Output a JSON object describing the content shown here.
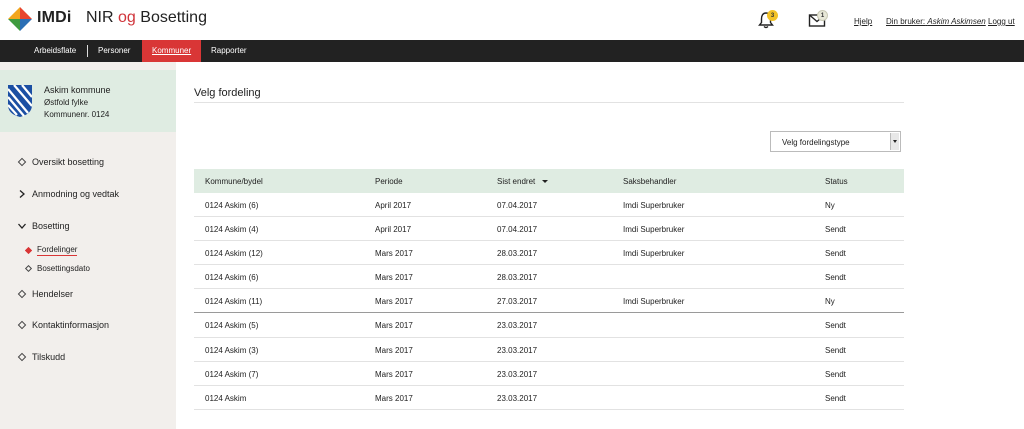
{
  "header": {
    "logo_text": "IMDi",
    "app_title_part1": "NIR",
    "app_title_og": "og",
    "app_title_part2": "Bosetting",
    "notifications_count": "3",
    "messages_count": "1",
    "help_label": "Hjelp",
    "user_prefix": "Din bruker:",
    "user_name": "Askim Askimsen",
    "logout_label": "Logg ut"
  },
  "nav": {
    "items": [
      {
        "label": "Arbeidsflate"
      },
      {
        "label": "Personer"
      },
      {
        "label": "Kommuner"
      },
      {
        "label": "Rapporter"
      }
    ],
    "active_index": 2
  },
  "sidebar": {
    "municipality": {
      "name": "Askim kommune",
      "county": "Østfold fylke",
      "number": "Kommunenr. 0124"
    },
    "items": [
      {
        "label": "Oversikt bosetting",
        "icon": "diamond-icon"
      },
      {
        "label": "Anmodning og vedtak",
        "icon": "chevron-right-icon"
      },
      {
        "label": "Bosetting",
        "icon": "chevron-down-icon"
      },
      {
        "label": "Hendelser",
        "icon": "diamond-icon"
      },
      {
        "label": "Kontaktinformasjon",
        "icon": "diamond-icon"
      },
      {
        "label": "Tilskudd",
        "icon": "diamond-icon"
      }
    ],
    "sub_items": [
      {
        "label": "Fordelinger",
        "active": true
      },
      {
        "label": "Bosettingsdato",
        "active": false
      }
    ]
  },
  "main": {
    "title": "Velg fordeling",
    "select_placeholder": "Velg fordelingstype",
    "table": {
      "columns": [
        "Kommune/bydel",
        "Periode",
        "Sist endret",
        "Saksbehandler",
        "Status"
      ],
      "sorted_column": "Sist endret",
      "rows": [
        [
          "0124 Askim (6)",
          "April 2017",
          "07.04.2017",
          "Imdi Superbruker",
          "Ny"
        ],
        [
          "0124 Askim (4)",
          "April 2017",
          "07.04.2017",
          "Imdi Superbruker",
          "Sendt"
        ],
        [
          "0124 Askim (12)",
          "Mars 2017",
          "28.03.2017",
          "Imdi Superbruker",
          "Sendt"
        ],
        [
          "0124 Askim (6)",
          "Mars 2017",
          "28.03.2017",
          "",
          "Sendt"
        ],
        [
          "0124 Askim (11)",
          "Mars 2017",
          "27.03.2017",
          "Imdi Superbruker",
          "Ny"
        ],
        [
          "0124 Askim (5)",
          "Mars 2017",
          "23.03.2017",
          "",
          "Sendt"
        ],
        [
          "0124 Askim (3)",
          "Mars 2017",
          "23.03.2017",
          "",
          "Sendt"
        ],
        [
          "0124 Askim (7)",
          "Mars 2017",
          "23.03.2017",
          "",
          "Sendt"
        ],
        [
          "0124 Askim",
          "Mars 2017",
          "23.03.2017",
          "",
          "Sendt"
        ]
      ]
    }
  },
  "colors": {
    "brand_red": "#d93636",
    "nav_bg": "#222222",
    "accent_green": "#dfece2",
    "sidebar_bg": "#f2efec",
    "badge_yellow": "#f2c228"
  }
}
